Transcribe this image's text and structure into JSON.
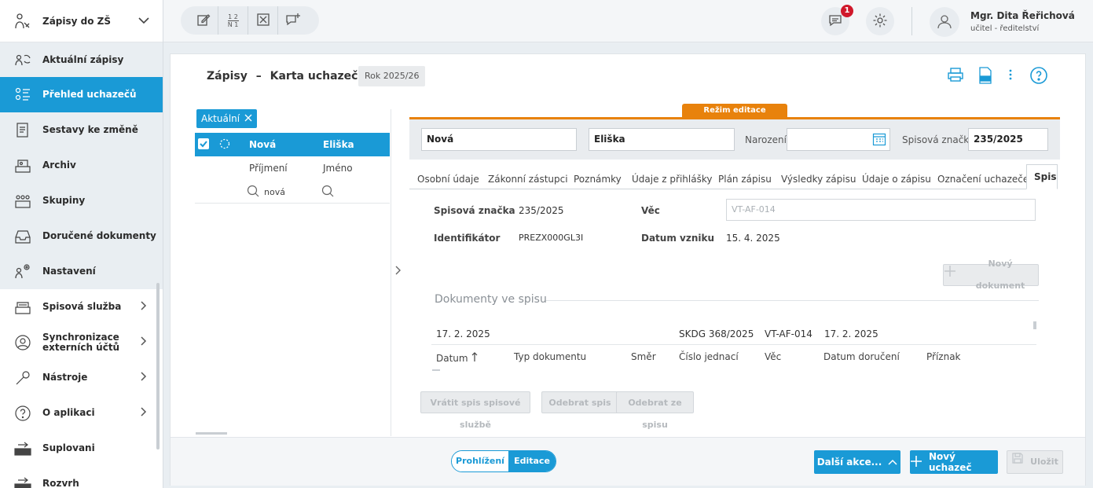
{
  "sidebar": {
    "header_label": "Zápisy do ZŠ",
    "items": [
      {
        "label": "Aktuální zápisy",
        "icon": "refresh-people-icon"
      },
      {
        "label": "Přehled uchazečů",
        "icon": "applicants-list-icon"
      },
      {
        "label": "Sestavy ke změně",
        "icon": "report-icon"
      },
      {
        "label": "Archiv",
        "icon": "archive-icon"
      },
      {
        "label": "Skupiny",
        "icon": "groups-icon"
      },
      {
        "label": "Doručené dokumenty",
        "icon": "inbox-icon"
      },
      {
        "label": "Nastavení",
        "icon": "settings-people-icon"
      },
      {
        "label": "Spisová služba",
        "icon": "file-service-icon"
      },
      {
        "label": "Synchronizace externích účtů",
        "icon": "sync-accounts-icon"
      },
      {
        "label": "Nástroje",
        "icon": "wrench-icon"
      },
      {
        "label": "O aplikaci",
        "icon": "question-icon"
      },
      {
        "label": "Suplovani",
        "icon": "substitution-icon"
      },
      {
        "label": "Rozvrh",
        "icon": "timetable-icon"
      }
    ]
  },
  "topbar": {
    "notifications_count": "1",
    "user_name": "Mgr. Dita Řeřichová",
    "user_role": "učitel - ředitelství",
    "tool_fraction_top": "1 2",
    "tool_fraction_bottom": "N 1"
  },
  "header": {
    "section": "Zápisy",
    "separator": "–",
    "page": "Karta uchazeče",
    "year": "Rok 2025/26"
  },
  "list": {
    "filter_chip": "Aktuální",
    "columns": {
      "surname": "Příjmení",
      "name": "Jméno"
    },
    "selected_row": {
      "surname": "Nová",
      "name": "Eliška"
    },
    "filter_surname_value": "nová"
  },
  "edit_mode_label": "Režim editace",
  "form": {
    "surname": "Nová",
    "name": "Eliška",
    "birth_label": "Narození",
    "birth_value": "",
    "file_no_label": "Spisová značka",
    "file_no_value": "235/2025"
  },
  "tabs": [
    "Osobní údaje",
    "Zákonní zástupci",
    "Poznámky",
    "Údaje z přihlášky",
    "Plán zápisu",
    "Výsledky zápisu",
    "Údaje o zápisu",
    "Označení uchazeče",
    "Spis"
  ],
  "spis": {
    "file_no_label": "Spisová značka",
    "file_no_value": "235/2025",
    "id_label": "Identifikátor",
    "id_value": "PREZX000GL3I",
    "subject_label": "Věc",
    "subject_placeholder": "VT-AF-014",
    "created_label": "Datum vzniku",
    "created_value": "15. 4. 2025",
    "new_doc_button": "Nový dokument",
    "docs_title": "Dokumenty ve spisu",
    "doc_columns": [
      "Datum",
      "Typ dokumentu",
      "Směr",
      "Číslo jednací",
      "Věc",
      "Datum doručení",
      "Příznak"
    ],
    "doc_rows": [
      {
        "date": "17. 2. 2025",
        "type": "",
        "direction": "",
        "ref": "SKDG 368/2025",
        "subject": "VT-AF-014",
        "delivered": "17. 2. 2025",
        "flag": ""
      }
    ],
    "actions": [
      "Vrátit spis spisové službě",
      "Odebrat spis",
      "Odebrat ze spisu"
    ]
  },
  "footer": {
    "mode_view": "Prohlížení",
    "mode_edit": "Editace",
    "more_actions": "Další akce...",
    "new_applicant": "Nový uchazeč",
    "save": "Uložit"
  },
  "colors": {
    "accent": "#1a9ad6",
    "edit_mode": "#e8820c",
    "badge": "#d0182b"
  }
}
